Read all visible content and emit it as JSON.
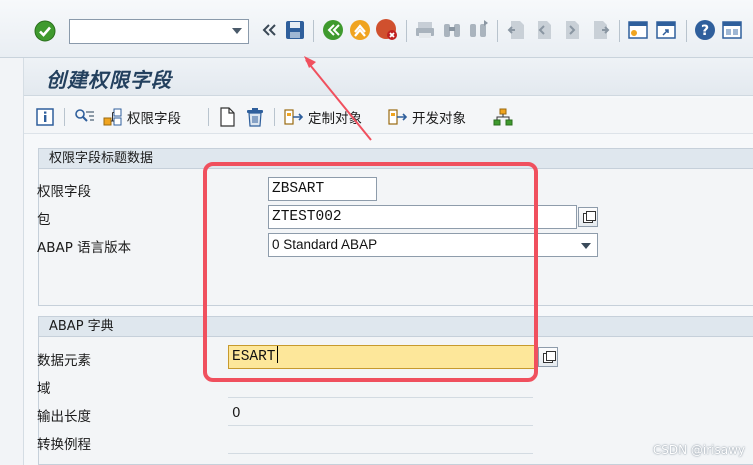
{
  "system_toolbar": {
    "command_field": {
      "value": "",
      "placeholder": ""
    },
    "icons": [
      "enter-icon",
      "back-chevrons-icon",
      "save-icon",
      "back-icon",
      "exit-icon",
      "cancel-icon",
      "print-icon",
      "find-icon",
      "find-next-icon",
      "first-page-icon",
      "previous-page-icon",
      "next-page-icon",
      "last-page-icon",
      "new-session-icon",
      "shortcut-icon",
      "help-icon",
      "layout-menu-icon"
    ]
  },
  "screen": {
    "title": "创建权限字段"
  },
  "app_toolbar": {
    "info_icon": "info-icon",
    "auth_field_label": "权限字段",
    "custom_object_label": "定制对象",
    "dev_object_label": "开发对象"
  },
  "header_group": {
    "title": "权限字段标题数据",
    "auth_field": {
      "label": "权限字段",
      "value": "ZBSART"
    },
    "package": {
      "label": "包",
      "value": "ZTEST002"
    },
    "abap_version": {
      "label": "ABAP 语言版本",
      "value": "0 Standard ABAP"
    }
  },
  "dictionary_group": {
    "title": "ABAP 字典",
    "data_element": {
      "label": "数据元素",
      "value": "ESART"
    },
    "domain": {
      "label": "域",
      "value": ""
    },
    "output_length": {
      "label": "输出长度",
      "value": "0"
    },
    "conversion_routine": {
      "label": "转换例程",
      "value": ""
    }
  },
  "watermark": "CSDN @irisawy",
  "colors": {
    "highlight": "#f0505e",
    "focus_field": "#fde79a",
    "title_text": "#23405e"
  }
}
